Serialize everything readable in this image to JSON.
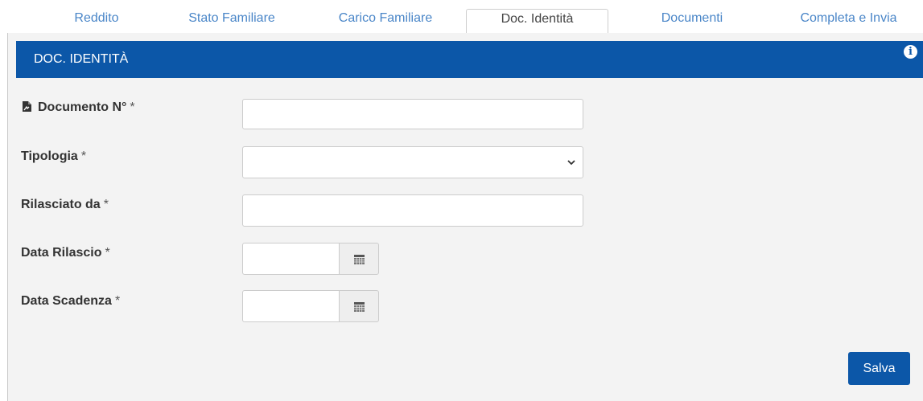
{
  "tabs": [
    {
      "label": "Reddito",
      "active": false
    },
    {
      "label": "Stato Familiare",
      "active": false
    },
    {
      "label": "Carico Familiare",
      "active": false
    },
    {
      "label": "Doc. Identità",
      "active": true
    },
    {
      "label": "Documenti",
      "active": false
    },
    {
      "label": "Completa e Invia",
      "active": false
    }
  ],
  "panel": {
    "title": "DOC. IDENTITÀ",
    "info_icon": "info-icon",
    "header_color": "#0c57a8"
  },
  "form": {
    "documento": {
      "label": "Documento N°",
      "required": "*",
      "value": "",
      "icon": "document-sign-icon"
    },
    "tipologia": {
      "label": "Tipologia",
      "required": "*",
      "value": ""
    },
    "rilasciato": {
      "label": "Rilasciato da",
      "required": "*",
      "value": ""
    },
    "data_rilascio": {
      "label": "Data Rilascio",
      "required": "*",
      "value": "",
      "icon": "calendar-icon"
    },
    "data_scadenza": {
      "label": "Data Scadenza",
      "required": "*",
      "value": "",
      "icon": "calendar-icon"
    }
  },
  "actions": {
    "save_label": "Salva"
  }
}
